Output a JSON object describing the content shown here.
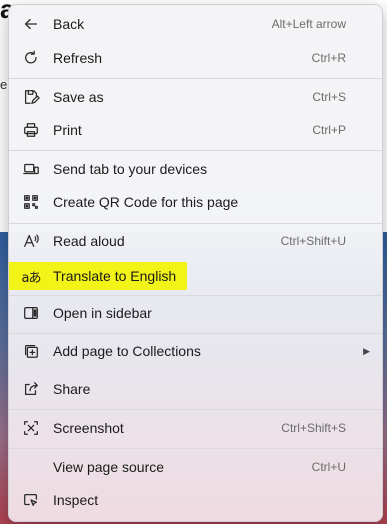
{
  "background": {
    "corner_letter": "a",
    "side_letter": "e"
  },
  "menu": {
    "items": [
      {
        "label": "Back",
        "shortcut": "Alt+Left arrow",
        "icon": "back-arrow-icon"
      },
      {
        "label": "Refresh",
        "shortcut": "Ctrl+R",
        "icon": "refresh-icon"
      },
      {
        "label": "Save as",
        "shortcut": "Ctrl+S",
        "icon": "save-as-icon"
      },
      {
        "label": "Print",
        "shortcut": "Ctrl+P",
        "icon": "printer-icon"
      },
      {
        "label": "Send tab to your devices",
        "shortcut": "",
        "icon": "send-to-devices-icon"
      },
      {
        "label": "Create QR Code for this page",
        "shortcut": "",
        "icon": "qr-code-icon"
      },
      {
        "label": "Read aloud",
        "shortcut": "Ctrl+Shift+U",
        "icon": "read-aloud-icon"
      },
      {
        "label": "Translate to English",
        "shortcut": "",
        "icon": "translate-icon",
        "highlight_color": "#f2f316"
      },
      {
        "label": "Open in sidebar",
        "shortcut": "",
        "icon": "sidebar-icon"
      },
      {
        "label": "Add page to Collections",
        "shortcut": "",
        "icon": "collections-icon",
        "submenu": true
      },
      {
        "label": "Share",
        "shortcut": "",
        "icon": "share-icon"
      },
      {
        "label": "Screenshot",
        "shortcut": "Ctrl+Shift+S",
        "icon": "screenshot-icon"
      },
      {
        "label": "View page source",
        "shortcut": "Ctrl+U",
        "icon": ""
      },
      {
        "label": "Inspect",
        "shortcut": "",
        "icon": "inspect-icon"
      }
    ],
    "translate_glyph": "aあ",
    "submenu_arrow": "▶"
  }
}
